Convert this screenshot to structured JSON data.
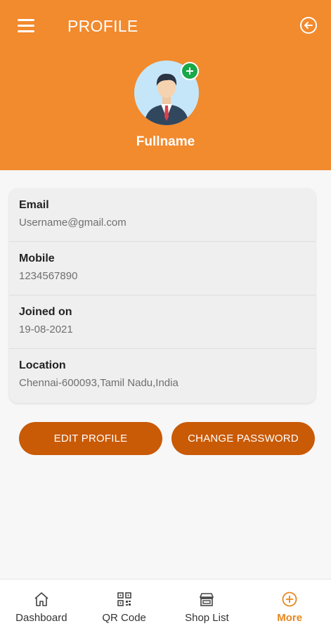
{
  "header": {
    "title": "PROFILE",
    "fullname": "Fullname"
  },
  "profile": [
    {
      "label": "Email",
      "value": "Username@gmail.com"
    },
    {
      "label": "Mobile",
      "value": "1234567890"
    },
    {
      "label": "Joined on",
      "value": "19-08-2021"
    },
    {
      "label": "Location",
      "value": "Chennai-600093,Tamil Nadu,India"
    }
  ],
  "actions": {
    "edit_label": "EDIT PROFILE",
    "password_label": "CHANGE PASSWORD"
  },
  "nav": [
    {
      "label": "Dashboard",
      "icon": "home-icon"
    },
    {
      "label": "QR Code",
      "icon": "qr-code-icon"
    },
    {
      "label": "Shop List",
      "icon": "store-icon"
    },
    {
      "label": "More",
      "icon": "plus-circle-icon",
      "active": true
    }
  ],
  "colors": {
    "header": "#f28a2e",
    "button": "#c95a06",
    "active_nav": "#e8871e",
    "add_badge": "#1aa84a"
  }
}
